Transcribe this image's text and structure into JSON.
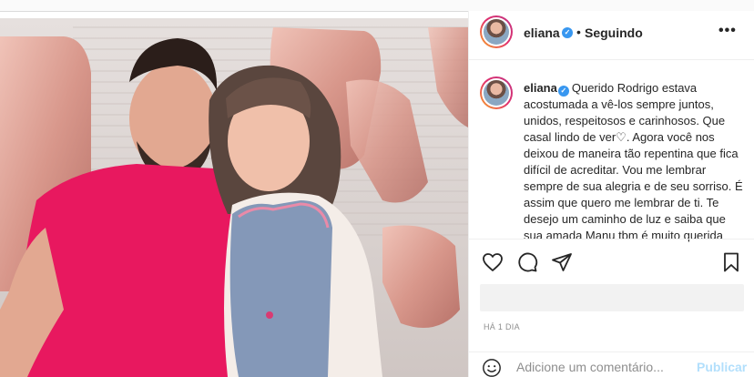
{
  "post": {
    "username": "eliana",
    "verified_mark": "✓",
    "separator": "•",
    "follow_status": "Seguindo",
    "more_label": "•••",
    "caption_username": "eliana",
    "caption_text": "Querido Rodrigo estava acostumada a vê-los sempre juntos, unidos, respeitosos e carinhosos. Que casal lindo de ver♡. Agora você nos deixou de maneira tão repentina que fica difícil de acreditar. Vou me lembrar sempre de sua alegria e de seu sorriso. É assim que quero me lembrar de ti. Te desejo um caminho de luz e saiba que sua amada Manu tbm é muito querida",
    "timestamp": "HÁ 1 DIA"
  },
  "actions": {
    "icons": [
      "heart-icon",
      "comment-icon",
      "share-icon",
      "bookmark-icon"
    ]
  },
  "comment": {
    "placeholder": "Adicione um comentário...",
    "publish_label": "Publicar"
  },
  "colors": {
    "accent_blue": "#3897f0",
    "publish_disabled": "#b2dffc",
    "shirt_pink": "#e8185f",
    "balloon_rose": "#d99a90"
  }
}
